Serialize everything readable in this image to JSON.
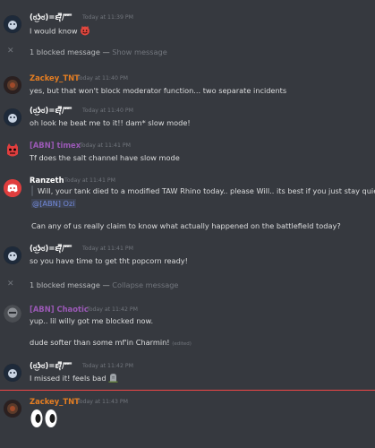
{
  "colors": {
    "background": "#36393f",
    "timestamp": "#72767d",
    "zackey": "#e67e22",
    "timex": "#9b59b6",
    "chaotic": "#9b59b6",
    "ranzeth": "#ffffff",
    "user": "#ffffff",
    "mention": "#7289da",
    "new_divider": "#f04747",
    "discord_blurple": "#7289da",
    "red_avatar": "#e03e3e"
  },
  "messages": [
    {
      "author": "(ಠ͜ʖಠ)=ε/̵͇̿̿/'̿'̿ ̿",
      "timestamp": "Today at 11:39 PM",
      "lines": [
        "I would know"
      ],
      "emoji": "grinning-devil-emoji"
    },
    {
      "blocked": "1 blocked message — ",
      "link": "Show message"
    },
    {
      "author": "Zackey_TNT",
      "timestamp": "Today at 11:40 PM",
      "lines": [
        "yes, but that won't block moderator function... two separate incidents"
      ]
    },
    {
      "author": "(ಠ͜ʖಠ)=ε/̵͇̿̿/'̿'̿ ̿",
      "timestamp": "Today at 11:40 PM",
      "lines": [
        "oh look he beat me to it!! dam* slow mode!"
      ]
    },
    {
      "author": "[ABN] timex",
      "timestamp": "Today at 11:41 PM",
      "lines": [
        "Tf does the salt channel have slow mode"
      ]
    },
    {
      "author": "Ranzeth",
      "timestamp": "Today at 11:41 PM",
      "quote": "Will, your tank died to a modified TAW Rhino today.. please Will.. its best if you just stay quiet.",
      "mention": "@[ABN] Ozi",
      "lines": [
        "Can any of us really claim to know what actually happened on the battlefield today?"
      ]
    },
    {
      "author": "(ಠ͜ʖಠ)=ε/̵͇̿̿/'̿'̿ ̿",
      "timestamp": "Today at 11:41 PM",
      "lines": [
        "so you have time to get tht popcorn ready!"
      ]
    },
    {
      "blocked": "1 blocked message — ",
      "link": "Collapse message"
    },
    {
      "author": "[ABN] Chaotic",
      "timestamp": "Today at 11:42 PM",
      "lines": [
        "yup.. lil willy got me blocked now.",
        "dude softer than some mf'in Charmin!"
      ],
      "edited": "(edited)"
    },
    {
      "author": "(ಠ͜ʖಠ)=ε/̵͇̿̿/'̿'̿ ̿",
      "timestamp": "Today at 11:42 PM",
      "lines": [
        "I missed it! feels bad"
      ],
      "emoji": "headstone-emoji"
    },
    {
      "author": "Zackey_TNT",
      "timestamp": "Today at 11:43 PM",
      "emoji": "eyes-emoji"
    }
  ]
}
